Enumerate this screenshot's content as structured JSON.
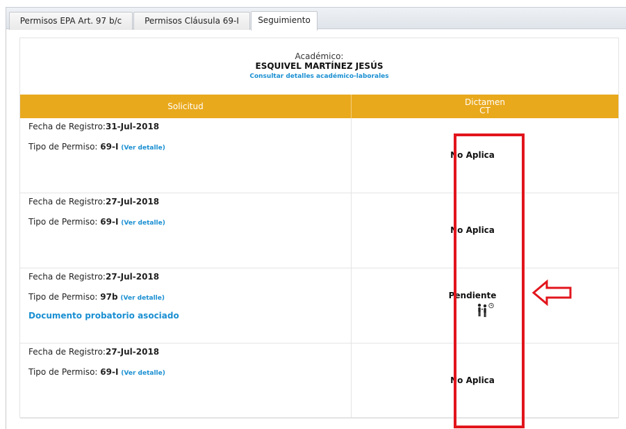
{
  "tabs": [
    {
      "label": "Permisos EPA Art. 97 b/c"
    },
    {
      "label": "Permisos Cláusula 69-I"
    },
    {
      "label": "Seguimiento"
    }
  ],
  "academic": {
    "label": "Académico:",
    "name": "ESQUIVEL MARTÍNEZ JESÚS",
    "details_link": "Consultar detalles académico-laborales"
  },
  "table": {
    "col_solicitud": "Solicitud",
    "col_dictamen_1": "Dictamen",
    "col_dictamen_2": "CT",
    "fecha_label": "Fecha de Registro:",
    "tipo_label": "Tipo de Permiso: ",
    "ver_detalle": "(Ver detalle)",
    "rows": [
      {
        "fecha": "31-Jul-2018",
        "tipo": "69-I",
        "status": "No Aplica"
      },
      {
        "fecha": "27-Jul-2018",
        "tipo": "69-I",
        "status": "No Aplica"
      },
      {
        "fecha": "27-Jul-2018",
        "tipo": "97b",
        "status": "Pendiente",
        "doc_link": "Documento probatorio asociado",
        "icon": "pending-person-icon"
      },
      {
        "fecha": "27-Jul-2018",
        "tipo": "69-I",
        "status": "No Aplica"
      }
    ]
  },
  "annotations": {
    "highlight_color": "#e2151c"
  },
  "colors": {
    "header": "#e9a91d",
    "link": "#1a8fd2"
  }
}
